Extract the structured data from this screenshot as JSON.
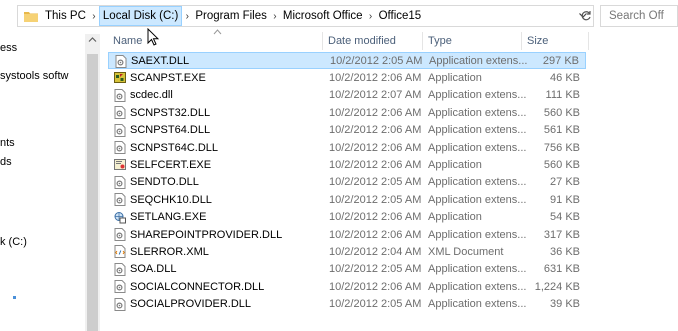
{
  "address_bar": {
    "breadcrumbs": [
      "This PC",
      "Local Disk (C:)",
      "Program Files",
      "Microsoft Office",
      "Office15"
    ],
    "highlighted_index": 1
  },
  "search": {
    "placeholder": "Search Off"
  },
  "nav_pane": {
    "items": [
      "ess",
      "systools softw",
      "nts",
      "ds",
      "k (C:)"
    ]
  },
  "columns": {
    "name": "Name",
    "date": "Date modified",
    "type": "Type",
    "size": "Size"
  },
  "files": [
    {
      "name": "SAEXT.DLL",
      "date": "10/2/2012 2:05 AM",
      "type": "Application extens...",
      "size": "297 KB",
      "icon": "dll-icon",
      "selected": true
    },
    {
      "name": "SCANPST.EXE",
      "date": "10/2/2012 2:06 AM",
      "type": "Application",
      "size": "46 KB",
      "icon": "scanpst-app-icon"
    },
    {
      "name": "scdec.dll",
      "date": "10/2/2012 2:07 AM",
      "type": "Application extens...",
      "size": "111 KB",
      "icon": "dll-icon"
    },
    {
      "name": "SCNPST32.DLL",
      "date": "10/2/2012 2:06 AM",
      "type": "Application extens...",
      "size": "560 KB",
      "icon": "dll-icon"
    },
    {
      "name": "SCNPST64.DLL",
      "date": "10/2/2012 2:06 AM",
      "type": "Application extens...",
      "size": "561 KB",
      "icon": "dll-icon"
    },
    {
      "name": "SCNPST64C.DLL",
      "date": "10/2/2012 2:06 AM",
      "type": "Application extens...",
      "size": "756 KB",
      "icon": "dll-icon"
    },
    {
      "name": "SELFCERT.EXE",
      "date": "10/2/2012 2:06 AM",
      "type": "Application",
      "size": "560 KB",
      "icon": "selfcert-app-icon"
    },
    {
      "name": "SENDTO.DLL",
      "date": "10/2/2012 2:05 AM",
      "type": "Application extens...",
      "size": "27 KB",
      "icon": "dll-icon"
    },
    {
      "name": "SEQCHK10.DLL",
      "date": "10/2/2012 2:05 AM",
      "type": "Application extens...",
      "size": "91 KB",
      "icon": "dll-icon"
    },
    {
      "name": "SETLANG.EXE",
      "date": "10/2/2012 2:06 AM",
      "type": "Application",
      "size": "54 KB",
      "icon": "setlang-app-icon"
    },
    {
      "name": "SHAREPOINTPROVIDER.DLL",
      "date": "10/2/2012 2:06 AM",
      "type": "Application extens...",
      "size": "317 KB",
      "icon": "dll-icon"
    },
    {
      "name": "SLERROR.XML",
      "date": "10/2/2012 2:04 AM",
      "type": "XML Document",
      "size": "36 KB",
      "icon": "xml-icon"
    },
    {
      "name": "SOA.DLL",
      "date": "10/2/2012 2:05 AM",
      "type": "Application extens...",
      "size": "631 KB",
      "icon": "dll-icon"
    },
    {
      "name": "SOCIALCONNECTOR.DLL",
      "date": "10/2/2012 2:06 AM",
      "type": "Application extens...",
      "size": "1,224 KB",
      "icon": "dll-icon"
    },
    {
      "name": "SOCIALPROVIDER.DLL",
      "date": "10/2/2012 2:05 AM",
      "type": "Application extens...",
      "size": "39 KB",
      "icon": "dll-icon"
    }
  ],
  "colors": {
    "selection": "#cce8ff",
    "selection_border": "#99d1ff",
    "header_text": "#4c607a",
    "meta_text": "#6d6d6d"
  }
}
